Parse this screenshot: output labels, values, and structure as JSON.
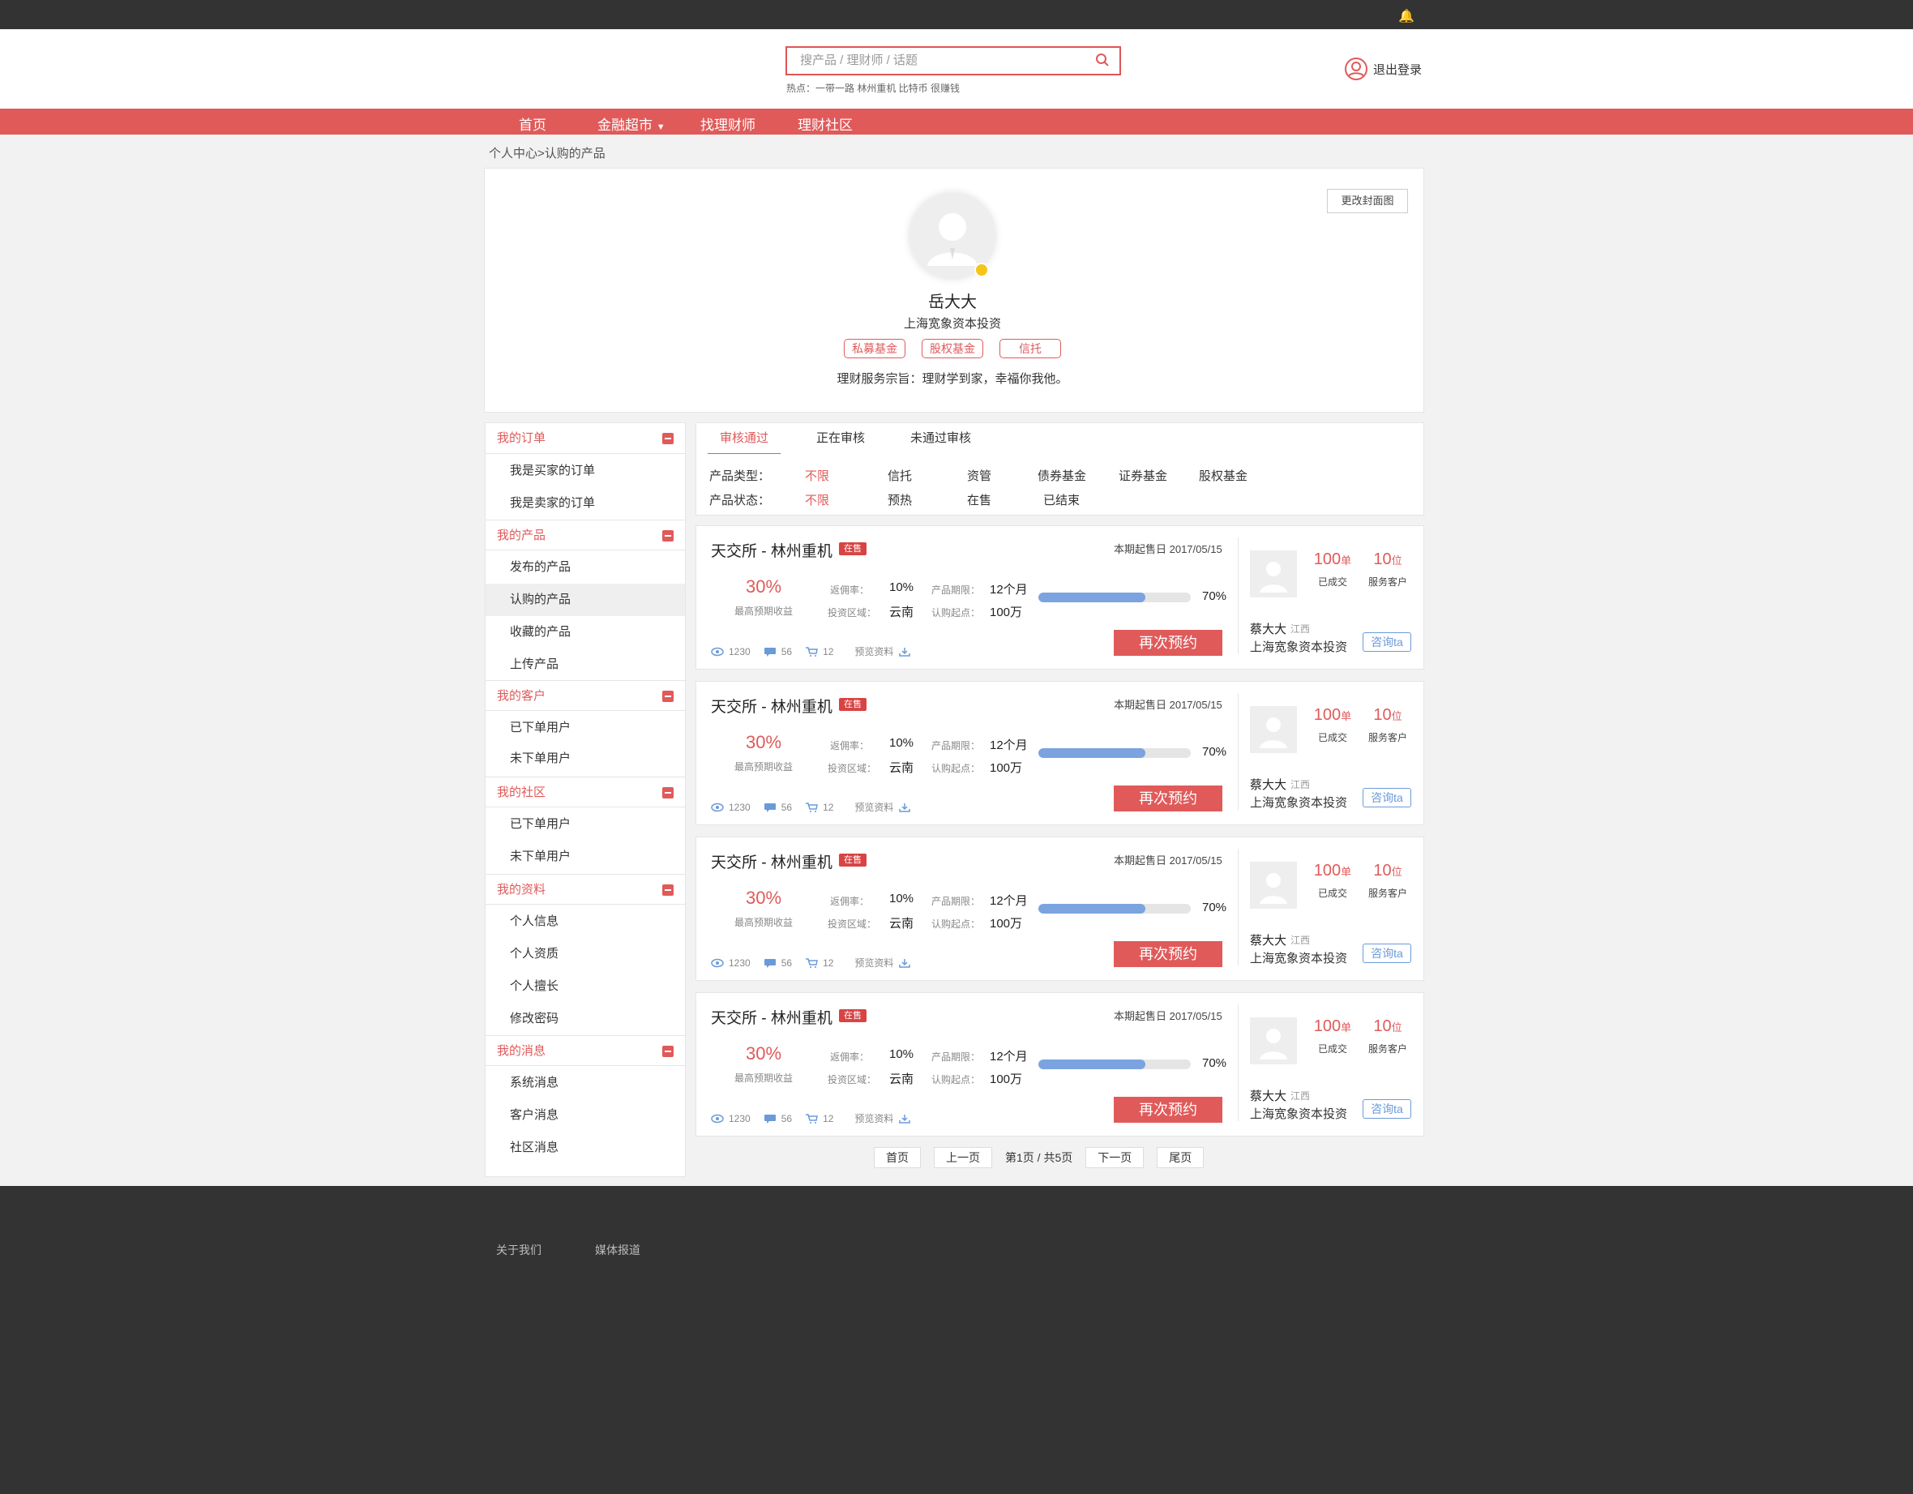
{
  "header": {
    "search_placeholder": "搜产品 / 理财师 / 话题",
    "hot": "热点：一带一路 林州重机 比特币 很赚钱",
    "login": "退出登录"
  },
  "nav": {
    "items": [
      "首页",
      "金融超市",
      "找理财师",
      "理财社区"
    ]
  },
  "breadcrumb": "个人中心>认购的产品",
  "profile": {
    "cover_button": "更改封面图",
    "name": "岳大大",
    "company": "上海宽象资本投资",
    "tags": [
      "私募基金",
      "股权基金",
      "信托"
    ],
    "motto": "理财服务宗旨：理财学到家，幸福你我他。"
  },
  "sidebar": {
    "groups": [
      {
        "title": "我的订单",
        "items": [
          "我是买家的订单",
          "我是卖家的订单"
        ]
      },
      {
        "title": "我的产品",
        "items": [
          "发布的产品",
          "认购的产品",
          "收藏的产品",
          "上传产品"
        ]
      },
      {
        "title": "我的客户",
        "items": [
          "已下单用户",
          "未下单用户"
        ]
      },
      {
        "title": "我的社区",
        "items": [
          "已下单用户",
          "未下单用户"
        ]
      },
      {
        "title": "我的资料",
        "items": [
          "个人信息",
          "个人资质",
          "个人擅长",
          "修改密码"
        ]
      },
      {
        "title": "我的消息",
        "items": [
          "系统消息",
          "客户消息",
          "社区消息"
        ]
      }
    ]
  },
  "tabs": [
    "审核通过",
    "正在审核",
    "未通过审核"
  ],
  "filters": {
    "type_label": "产品类型：",
    "type_options": [
      "不限",
      "信托",
      "资管",
      "债券基金",
      "证券基金",
      "股权基金"
    ],
    "status_label": "产品状态：",
    "status_options": [
      "不限",
      "预热",
      "在售",
      "已结束"
    ]
  },
  "product": {
    "title": "天交所 - 林州重机",
    "sale_badge": "在售",
    "date": "本期起售日 2017/05/15",
    "rate": "30%",
    "rate_label": "最高预期收益",
    "return_label": "返佣率：",
    "return_value": "10%",
    "region_label": "投资区域：",
    "region_value": "云南",
    "term_label": "产品期限：",
    "term_value": "12个月",
    "min_label": "认购起点：",
    "min_value": "100万",
    "progress": 0.7,
    "progress_text": "70%",
    "button": "再次预约",
    "views": "1230",
    "comments": "56",
    "cart": "12",
    "preview": "预览资料",
    "deals": "100",
    "deals_unit": "单",
    "deals_label": "已成交",
    "clients": "10",
    "clients_unit": "位",
    "clients_label": "服务客户",
    "advisor": "蔡大大",
    "region": "江西",
    "company": "上海宽象资本投资",
    "ask": "咨询ta"
  },
  "pagination": {
    "first": "首页",
    "prev": "上一页",
    "info": "第1页 / 共5页",
    "next": "下一页",
    "last": "尾页"
  },
  "footer": {
    "links": [
      "关于我们",
      "媒体报道"
    ]
  },
  "colors": {
    "brand": "#e05a5a",
    "progress": "#7ba3e0",
    "link": "#6b9ad8",
    "footer": "#333333"
  }
}
